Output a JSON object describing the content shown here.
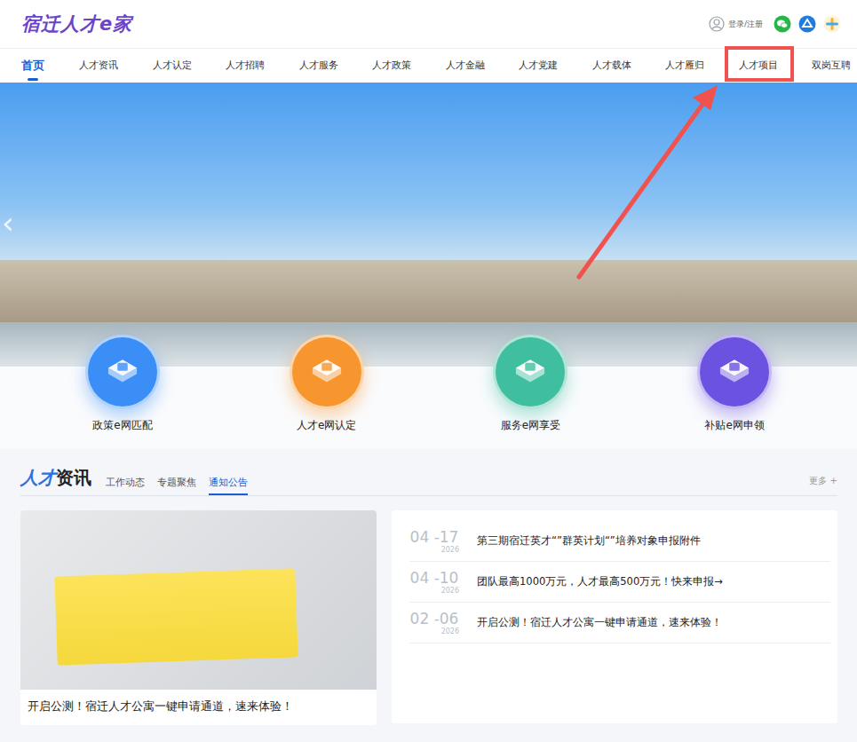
{
  "header": {
    "logo": "宿迁人才e家",
    "login": "登录/注册"
  },
  "nav": [
    {
      "label": "首页",
      "selected": true,
      "annotated": false
    },
    {
      "label": "人才资讯",
      "selected": false,
      "annotated": false
    },
    {
      "label": "人才认定",
      "selected": false,
      "annotated": false
    },
    {
      "label": "人才招聘",
      "selected": false,
      "annotated": false
    },
    {
      "label": "人才服务",
      "selected": false,
      "annotated": false
    },
    {
      "label": "人才政策",
      "selected": false,
      "annotated": false
    },
    {
      "label": "人才金融",
      "selected": false,
      "annotated": false
    },
    {
      "label": "人才党建",
      "selected": false,
      "annotated": false
    },
    {
      "label": "人才载体",
      "selected": false,
      "annotated": false
    },
    {
      "label": "人才雁归",
      "selected": false,
      "annotated": false
    },
    {
      "label": "人才项目",
      "selected": false,
      "annotated": true
    },
    {
      "label": "双岗互聘",
      "selected": false,
      "annotated": false
    }
  ],
  "banner": {
    "prev": "‹"
  },
  "features": [
    {
      "label": "政策e网匹配",
      "color": "#3a8ef6"
    },
    {
      "label": "人才e网认定",
      "color": "#f7962f"
    },
    {
      "label": "服务e网享受",
      "color": "#3fbf9f"
    },
    {
      "label": "补贴e网申领",
      "color": "#6b52e0"
    }
  ],
  "news": {
    "title_accent": "人才",
    "title_rest": "资讯",
    "tabs": [
      {
        "label": "工作动态",
        "selected": false
      },
      {
        "label": "专题聚焦",
        "selected": false
      },
      {
        "label": "通知公告",
        "selected": true
      }
    ],
    "more": "更多 +",
    "featured_caption": "开启公测！宿迁人才公寓一键申请通道，速来体验！",
    "items": [
      {
        "month_day": "04 -17",
        "year": "2026",
        "title": "第三期宿迁英才“”群英计划“”培养对象申报附件"
      },
      {
        "month_day": "04 -10",
        "year": "2026",
        "title": "团队最高1000万元，人才最高500万元！快来申报→"
      },
      {
        "month_day": "02 -06",
        "year": "2026",
        "title": "开启公测！宿迁人才公寓一键申请通道，速来体验！"
      }
    ]
  }
}
